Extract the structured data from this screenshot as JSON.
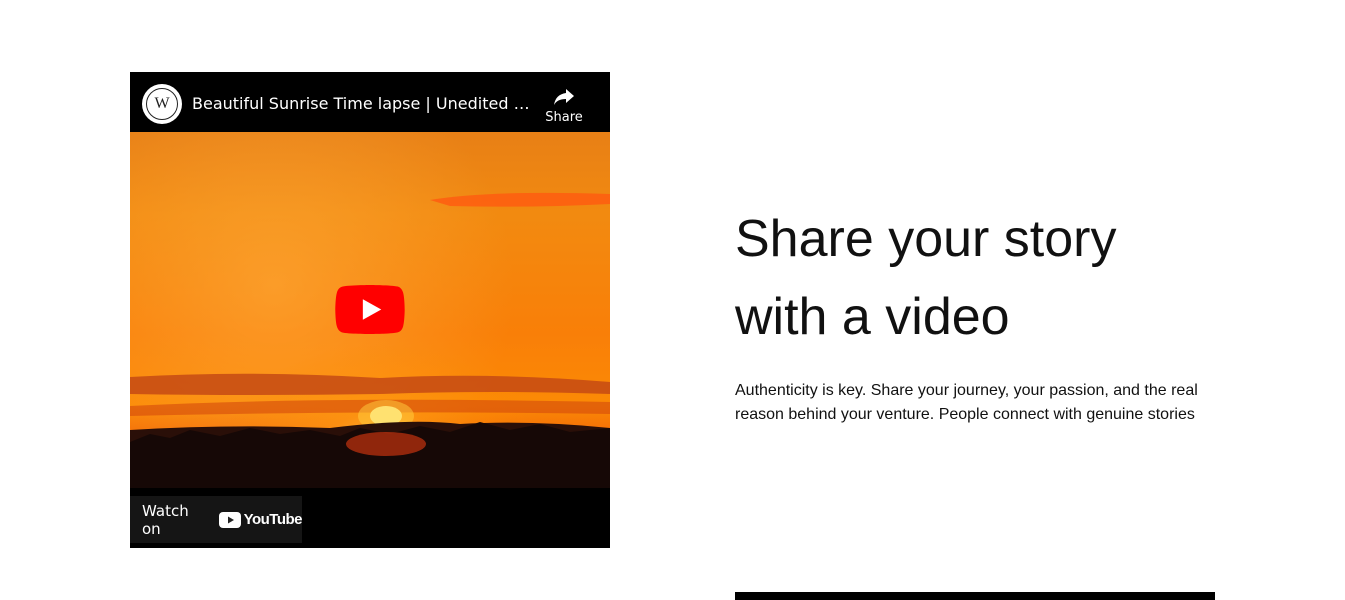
{
  "video": {
    "title": "Beautiful Sunrise Time lapse | Unedited | Nature",
    "channel_avatar_letter": "W",
    "share_label": "Share",
    "watch_on_label": "Watch on",
    "youtube_wordmark": "YouTube",
    "play_button_color": "#ff0000"
  },
  "section": {
    "headline_line1": "Share your story",
    "headline_line2": "with a video",
    "body": "Authenticity is key. Share your journey, your passion, and the real reason behind your venture. People connect with genuine stories"
  }
}
